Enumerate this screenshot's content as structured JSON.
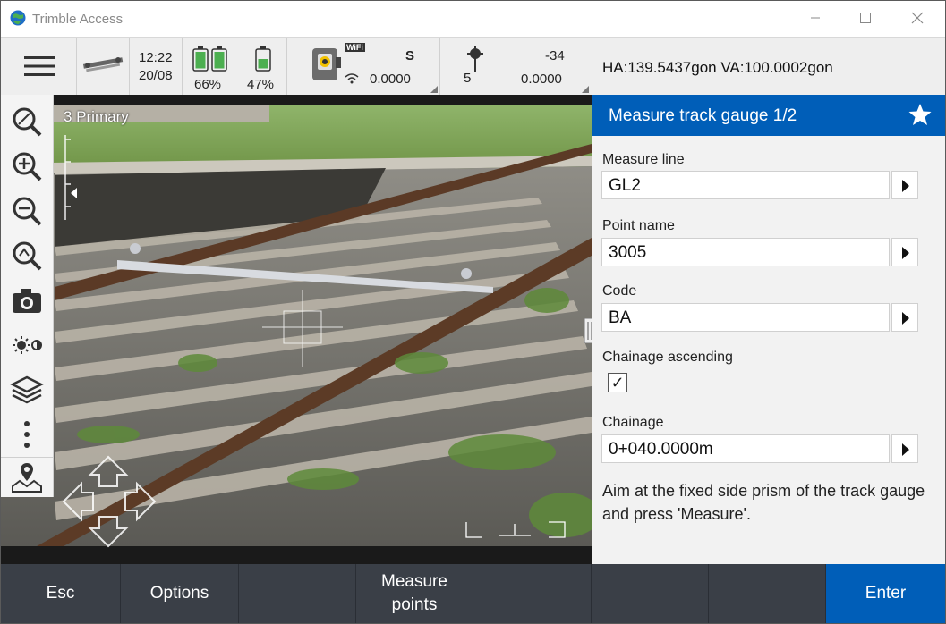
{
  "window": {
    "title": "Trimble Access",
    "minimize_icon": "minimize-icon",
    "maximize_icon": "maximize-icon",
    "close_icon": "close-icon"
  },
  "status": {
    "time": "12:22",
    "date": "20/08",
    "battery1": "66%",
    "battery2": "47%",
    "wifi_badge": "WiFi",
    "instrument_mode": "S",
    "instrument_value": "0.0000",
    "target_number": "5",
    "target_top": "-34",
    "target_value": "0.0000"
  },
  "angles": {
    "text": "HA:139.5437gon  VA:100.0002gon"
  },
  "camera": {
    "view_label": "3 Primary"
  },
  "form": {
    "title": "Measure track gauge 1/2",
    "measure_line_label": "Measure line",
    "measure_line_value": "GL2",
    "point_name_label": "Point name",
    "point_name_value": "3005",
    "code_label": "Code",
    "code_value": "BA",
    "chainage_ascending_label": "Chainage ascending",
    "chainage_ascending_check": "✓",
    "chainage_label": "Chainage",
    "chainage_value": "0+040.0000m",
    "instructions": "Aim at the fixed side prism of the track gauge and press 'Measure'."
  },
  "bottom": {
    "esc": "Esc",
    "options": "Options",
    "measure_points_1": "Measure",
    "measure_points_2": "points",
    "enter": "Enter"
  },
  "colors": {
    "accent": "#005eb8",
    "bottom_bar": "#3a3f47"
  }
}
